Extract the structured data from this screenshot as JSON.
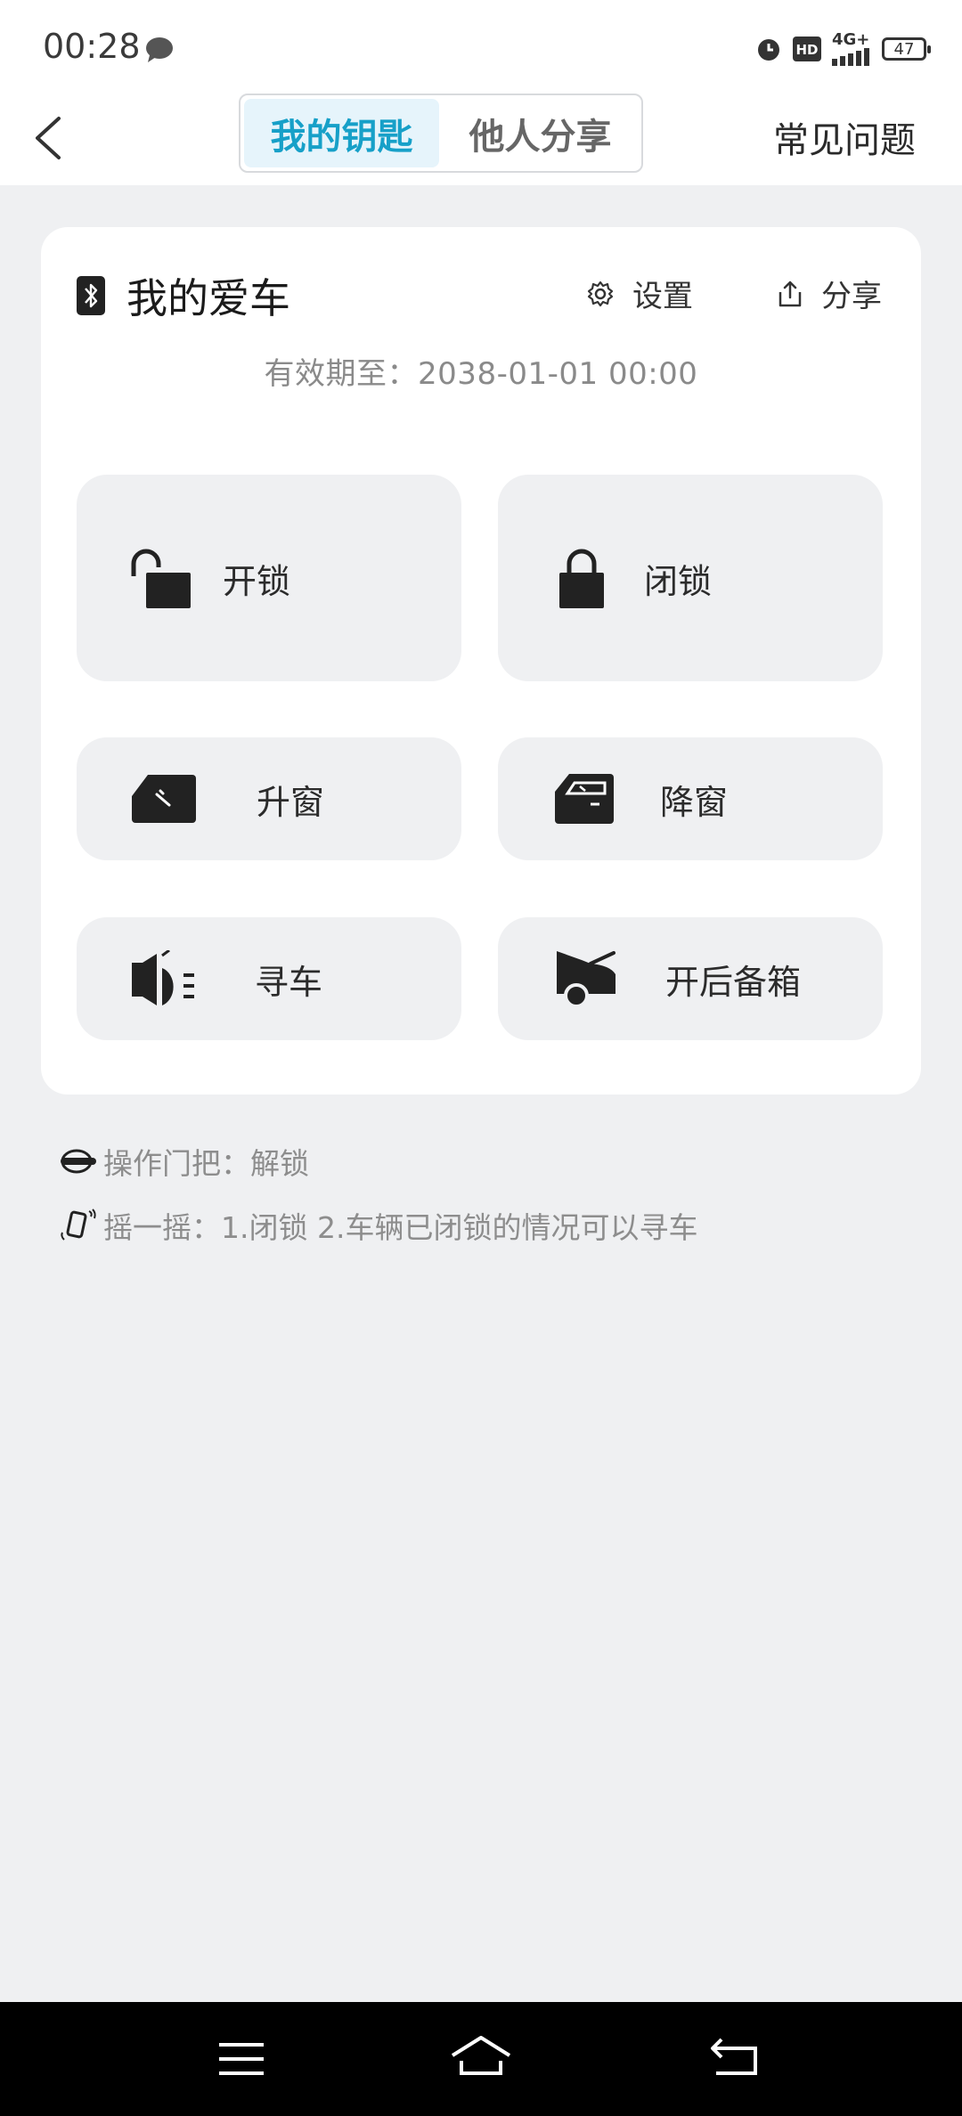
{
  "status_bar": {
    "time": "00:28",
    "network": "4G+",
    "battery": "47"
  },
  "header": {
    "tabs": [
      {
        "label": "我的钥匙",
        "active": true
      },
      {
        "label": "他人分享",
        "active": false
      }
    ],
    "faq_label": "常见问题"
  },
  "card": {
    "car_name": "我的爱车",
    "settings_label": "设置",
    "share_label": "分享",
    "validity": "有效期至：2038-01-01 00:00",
    "actions": {
      "unlock": "开锁",
      "lock": "闭锁",
      "window_up": "升窗",
      "window_down": "降窗",
      "find_car": "寻车",
      "open_trunk": "开后备箱"
    }
  },
  "tips": [
    {
      "icon": "door-handle-icon",
      "text": "操作门把：解锁"
    },
    {
      "icon": "shake-phone-icon",
      "text": "摇一摇：1.闭锁 2.车辆已闭锁的情况可以寻车"
    }
  ],
  "colors": {
    "accent": "#17a0c8",
    "tab_active_bg": "#e6f4fb",
    "page_bg": "#eff0f2"
  }
}
